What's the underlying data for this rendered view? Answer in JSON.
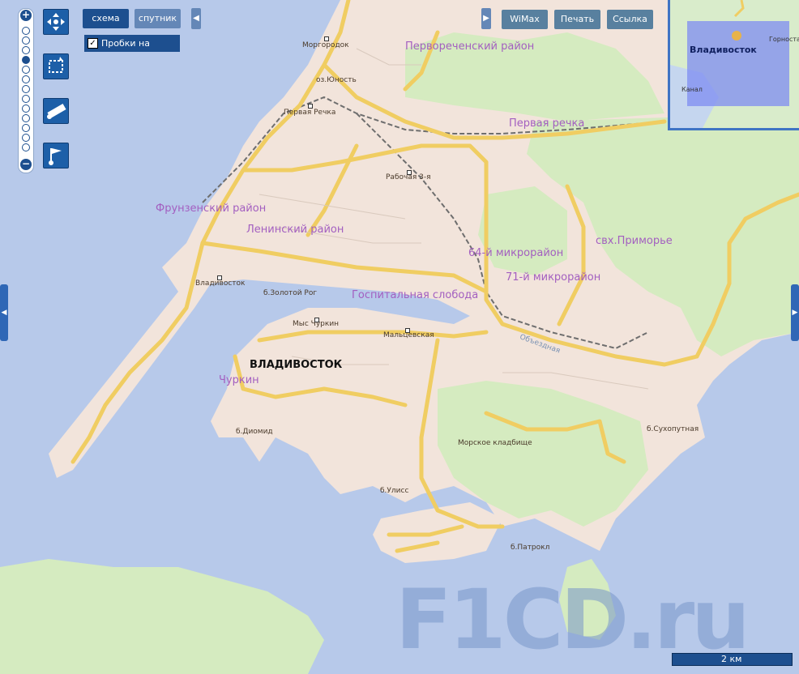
{
  "map": {
    "districts": [
      "Первореченский район",
      "Первая речка",
      "Фрунзенский район",
      "Ленинский район",
      "64-й микрорайон",
      "71-й микрорайон",
      "свх.Приморье",
      "Госпитальная слобода",
      "Чуркин"
    ],
    "places": [
      "Моргородок",
      "оз.Юность",
      "Первая Речка",
      "Рабочая 3-я",
      "Владивосток",
      "б.Золотой Рог",
      "Мыс Чуркин",
      "Мальцевская",
      "б.Диомид",
      "Морское кладбище",
      "б.Улисс",
      "б.Патрокл",
      "б.Сухопутная",
      "Объездная"
    ],
    "city_label": "ВЛАДИВОСТОК",
    "colors": {
      "water": "#b7c9ea",
      "land": "#f3e5dc",
      "green": "#d4ebc0",
      "road": "#f5d67a",
      "rail": "#6e6e6e"
    }
  },
  "toolbar": {
    "scheme": "схема",
    "satellite": "спутник",
    "wimax": "WiMax",
    "print": "Печать",
    "link": "Ссылка",
    "traffic_label": "Пробки на",
    "traffic_checked": true
  },
  "zoom": {
    "plus": "+",
    "minus": "−"
  },
  "tools": [
    "move-icon",
    "select-area-icon",
    "ruler-icon",
    "route-flag-icon"
  ],
  "minimap": {
    "city": "Владивосток",
    "labels": [
      "Горноста",
      "Канал"
    ]
  },
  "scale": "2 км",
  "watermark": "F1CD.ru"
}
